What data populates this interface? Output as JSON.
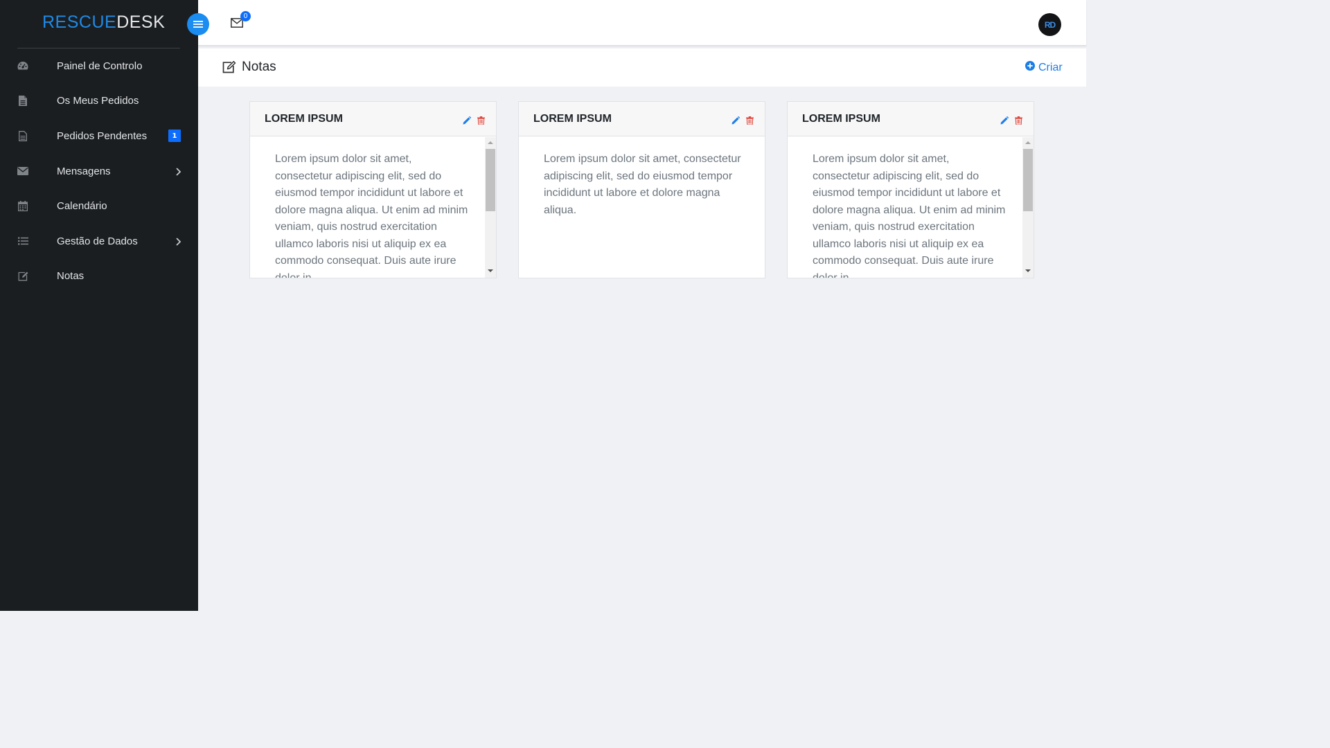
{
  "app": {
    "logo_part1": "RESCUE",
    "logo_part2": "DESK"
  },
  "sidebar": {
    "items": [
      {
        "label": "Painel de Controlo",
        "icon": "dashboard-icon"
      },
      {
        "label": "Os Meus Pedidos",
        "icon": "file-icon"
      },
      {
        "label": "Pedidos Pendentes",
        "icon": "file-outline-icon",
        "badge": "1"
      },
      {
        "label": "Mensagens",
        "icon": "envelope-icon",
        "chevron": true
      },
      {
        "label": "Calendário",
        "icon": "calendar-icon"
      },
      {
        "label": "Gestão de Dados",
        "icon": "list-icon",
        "chevron": true
      },
      {
        "label": "Notas",
        "icon": "edit-icon"
      }
    ]
  },
  "topbar": {
    "mail_count": "0",
    "avatar_initials": "RD"
  },
  "page": {
    "title": "Notas",
    "create_label": "Criar"
  },
  "notes": [
    {
      "title": "LOREM IPSUM",
      "text": "Lorem ipsum dolor sit amet, consectetur adipiscing elit, sed do eiusmod tempor incididunt ut labore et dolore magna aliqua. Ut enim ad minim veniam, quis nostrud exercitation ullamco laboris nisi ut aliquip ex ea commodo consequat. Duis aute irure dolor in",
      "scrollable": true
    },
    {
      "title": "LOREM IPSUM",
      "text": "Lorem ipsum dolor sit amet, consectetur adipiscing elit, sed do eiusmod tempor incididunt ut labore et dolore magna aliqua.",
      "scrollable": false
    },
    {
      "title": "LOREM IPSUM",
      "text": "Lorem ipsum dolor sit amet, consectetur adipiscing elit, sed do eiusmod tempor incididunt ut labore et dolore magna aliqua. Ut enim ad minim veniam, quis nostrud exercitation ullamco laboris nisi ut aliquip ex ea commodo consequat. Duis aute irure dolor in",
      "scrollable": true
    }
  ],
  "colors": {
    "sidebar_bg": "#1b1e21",
    "accent": "#1b8cf0",
    "badge": "#0d6efd",
    "delete": "#dc3545",
    "content_bg": "#f0f1f5"
  }
}
